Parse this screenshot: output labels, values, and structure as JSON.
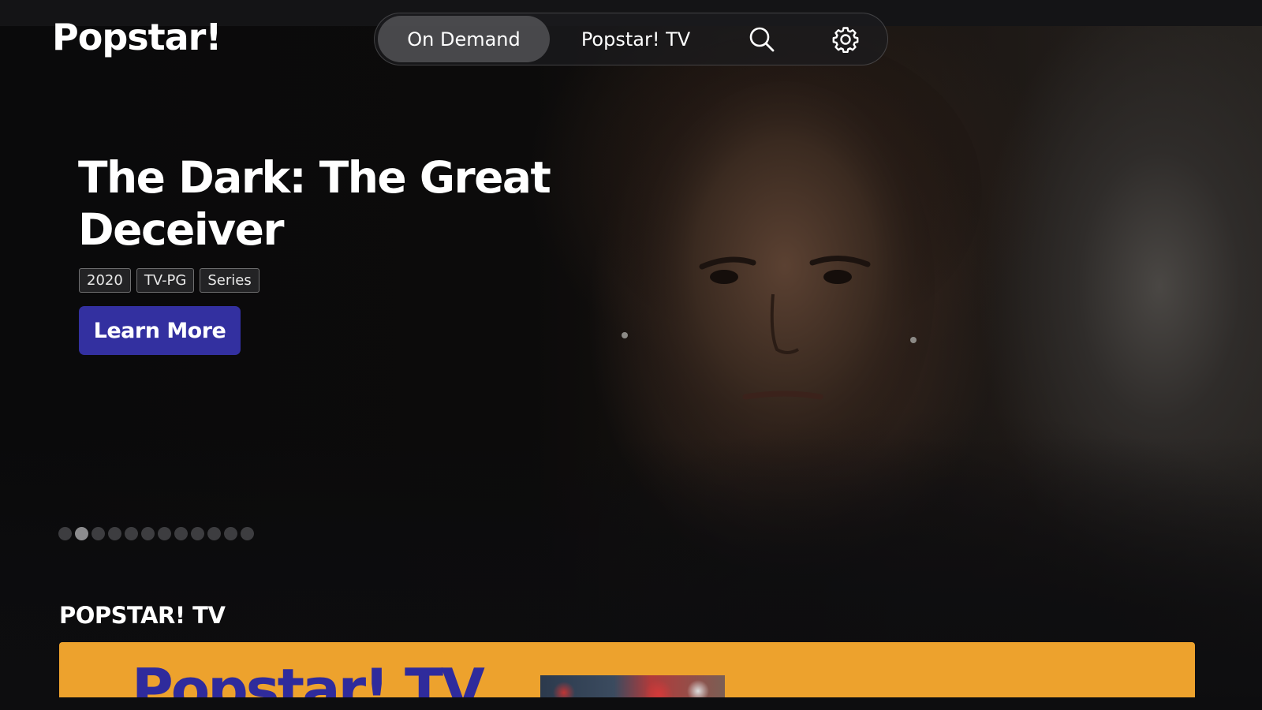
{
  "app": {
    "logo_text": "Popstar!"
  },
  "nav": {
    "tabs": [
      {
        "label": "On Demand",
        "active": true
      },
      {
        "label": "Popstar! TV",
        "active": false
      }
    ],
    "icons": [
      "search-icon",
      "gear-icon"
    ]
  },
  "hero": {
    "title": "The Dark: The Great Deceiver",
    "badges": [
      "2020",
      "TV-PG",
      "Series"
    ],
    "cta_label": "Learn More",
    "carousel": {
      "total": 12,
      "active_index": 1
    }
  },
  "section": {
    "title": "POPSTAR! TV",
    "card_logo_text": "Popstar! TV"
  },
  "colors": {
    "accent_button": "#3330a0",
    "card_background": "#eda22d",
    "card_logo": "#2f2b9c"
  }
}
